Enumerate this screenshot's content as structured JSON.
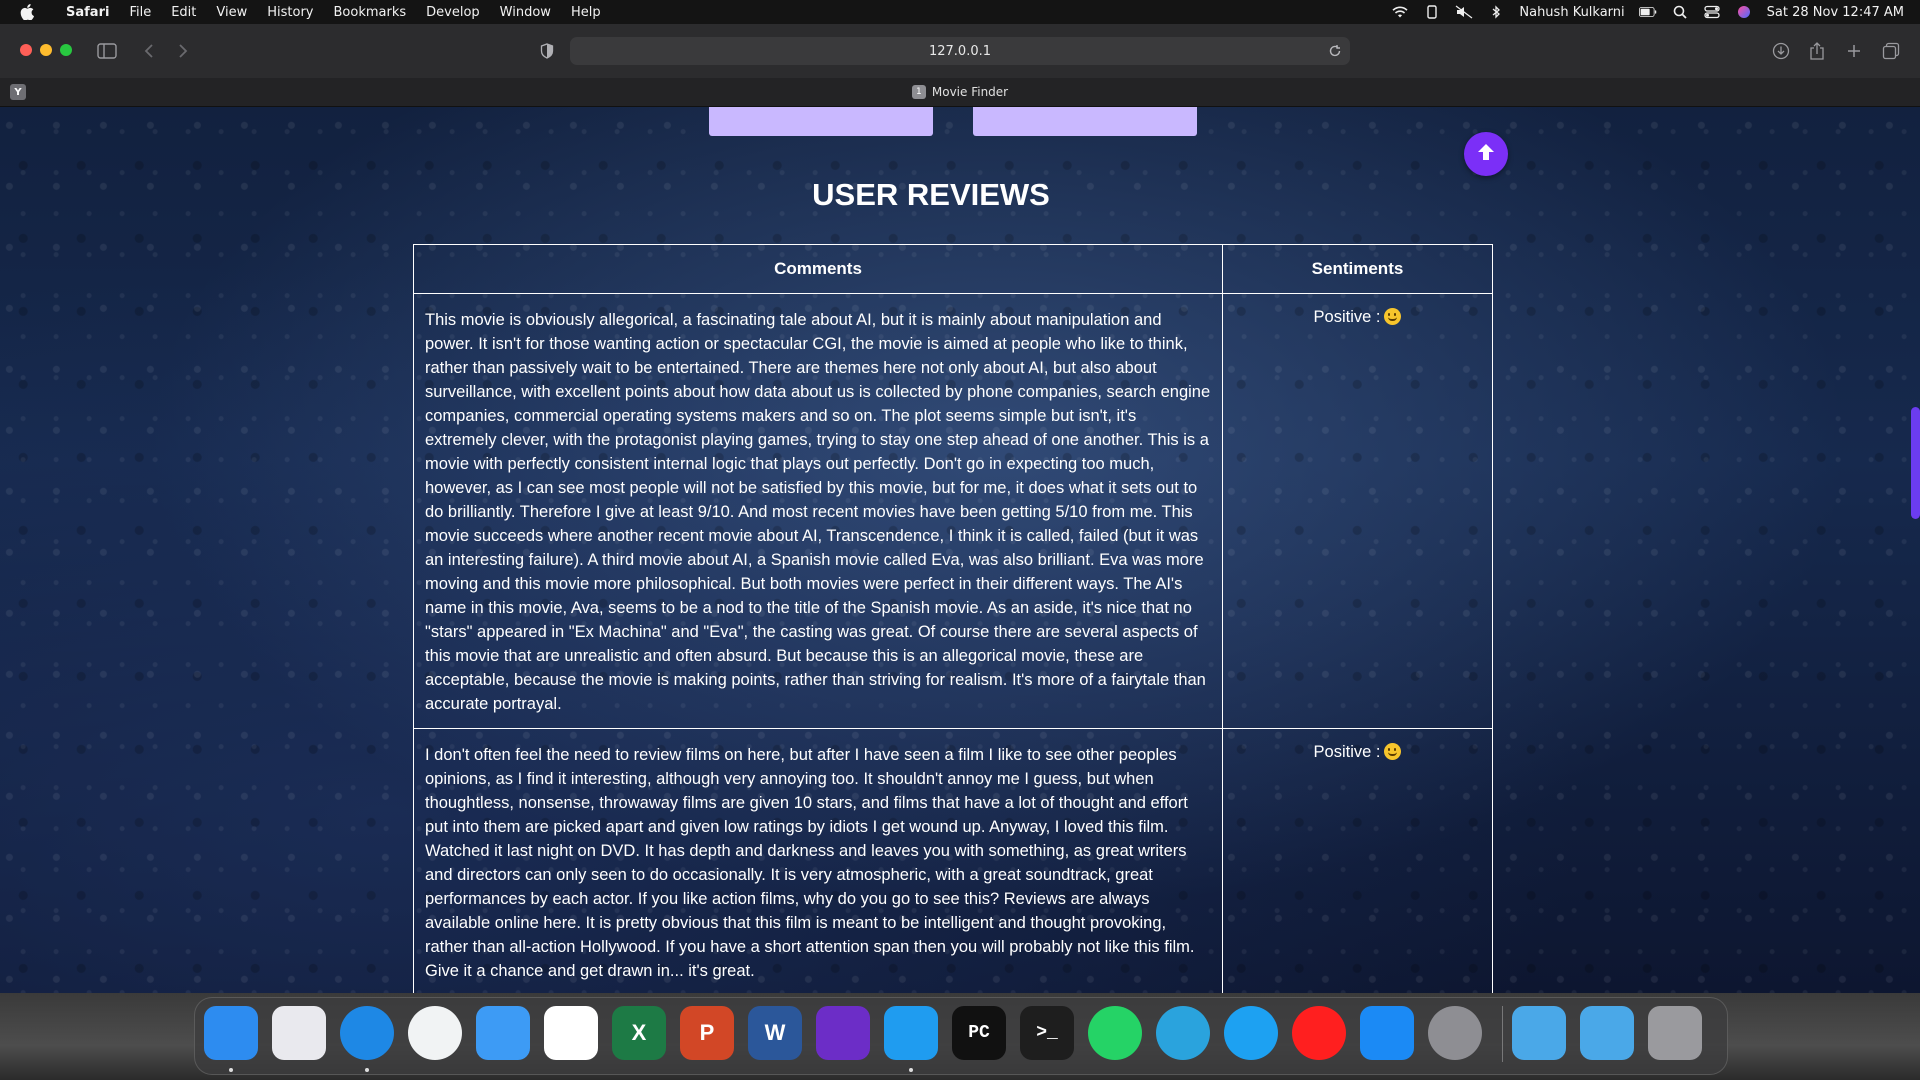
{
  "menubar": {
    "items": [
      "Safari",
      "File",
      "Edit",
      "View",
      "History",
      "Bookmarks",
      "Develop",
      "Window",
      "Help"
    ],
    "user_name": "Nahush Kulkarni",
    "clock": "Sat 28 Nov  12:47 AM"
  },
  "browser": {
    "url": "127.0.0.1",
    "tab_badge": "1",
    "tab_title": "Movie Finder",
    "favorite_letter": "Y"
  },
  "page": {
    "section_title": "USER REVIEWS",
    "table": {
      "headers": [
        "Comments",
        "Sentiments"
      ],
      "rows": [
        {
          "comment": "This movie is obviously allegorical, a fascinating tale about AI, but it is mainly about manipulation and power. It isn't for those wanting action or spectacular CGI, the movie is aimed at people who like to think, rather than passively wait to be entertained. There are themes here not only about AI, but also about surveillance, with excellent points about how data about us is collected by phone companies, search engine companies, commercial operating systems makers and so on. The plot seems simple but isn't, it's extremely clever, with the protagonist playing games, trying to stay one step ahead of one another. This is a movie with perfectly consistent internal logic that plays out perfectly. Don't go in expecting too much, however, as I can see most people will not be satisfied by this movie, but for me, it does what it sets out to do brilliantly. Therefore I give at least 9/10. And most recent movies have been getting 5/10 from me. This movie succeeds where another recent movie about AI, Transcendence, I think it is called, failed (but it was an interesting failure). A third movie about AI, a Spanish movie called Eva, was also brilliant. Eva was more moving and this movie more philosophical. But both movies were perfect in their different ways. The AI's name in this movie, Ava, seems to be a nod to the title of the Spanish movie. As an aside, it's nice that no \"stars\" appeared in \"Ex Machina\" and \"Eva\", the casting was great. Of course there are several aspects of this movie that are unrealistic and often absurd. But because this is an allegorical movie, these are acceptable, because the movie is making points, rather than striving for realism. It's more of a fairytale than accurate portrayal.",
          "sentiment": "Positive :"
        },
        {
          "comment": "I don't often feel the need to review films on here, but after I have seen a film I like to see other peoples opinions, as I find it interesting, although very annoying too. It shouldn't annoy me I guess, but when thoughtless, nonsense, throwaway films are given 10 stars, and films that have a lot of thought and effort put into them are picked apart and given low ratings by idiots I get wound up. Anyway, I loved this film. Watched it last night on DVD. It has depth and darkness and leaves you with something, as great writers and directors can only seen to do occasionally. It is very atmospheric, with a great soundtrack, great performances by each actor. If you like action films, why do you go to see this? Reviews are always available online here. It is pretty obvious that this film is meant to be intelligent and thought provoking, rather than all-action Hollywood. If you have a short attention span then you will probably not like this film. Give it a chance and get drawn in... it's great.",
          "sentiment": "Positive :"
        }
      ]
    }
  },
  "dock": {
    "apps": [
      {
        "name": "finder",
        "color": "#2d8cf0",
        "glyph": ""
      },
      {
        "name": "launchpad",
        "color": "#e9e9ee",
        "glyph": ""
      },
      {
        "name": "safari",
        "color": "#1e88e5",
        "glyph": ""
      },
      {
        "name": "chrome",
        "color": "#f1f3f4",
        "glyph": ""
      },
      {
        "name": "mail",
        "color": "#3d9bf5",
        "glyph": ""
      },
      {
        "name": "photos",
        "color": "#ffffff",
        "glyph": ""
      },
      {
        "name": "excel",
        "color": "#1d7a45",
        "glyph": "X"
      },
      {
        "name": "powerpoint",
        "color": "#d24726",
        "glyph": "P"
      },
      {
        "name": "word",
        "color": "#2b579a",
        "glyph": "W"
      },
      {
        "name": "visual-studio",
        "color": "#6c2dc7",
        "glyph": ""
      },
      {
        "name": "vscode",
        "color": "#1f9cf0",
        "glyph": ""
      },
      {
        "name": "pycharm",
        "color": "#111111",
        "glyph": "PC"
      },
      {
        "name": "terminal",
        "color": "#1e1e1e",
        "glyph": ">_"
      },
      {
        "name": "whatsapp",
        "color": "#25d366",
        "glyph": ""
      },
      {
        "name": "telegram",
        "color": "#2aa3dd",
        "glyph": ""
      },
      {
        "name": "twitter",
        "color": "#1da1f2",
        "glyph": ""
      },
      {
        "name": "youtube",
        "color": "#ff1f1f",
        "glyph": ""
      },
      {
        "name": "app-store",
        "color": "#1b8af5",
        "glyph": ""
      },
      {
        "name": "system-preferences",
        "color": "#8e8e93",
        "glyph": ""
      },
      {
        "name": "downloads-folder",
        "color": "#4aa8e8",
        "glyph": ""
      },
      {
        "name": "applications-folder",
        "color": "#4aa8e8",
        "glyph": ""
      },
      {
        "name": "trash",
        "color": "#9a9a9e",
        "glyph": ""
      }
    ]
  },
  "colors": {
    "accent": "#7b2ff7",
    "button_lavender": "#c9b8ff",
    "page_bg": "#16294d"
  }
}
